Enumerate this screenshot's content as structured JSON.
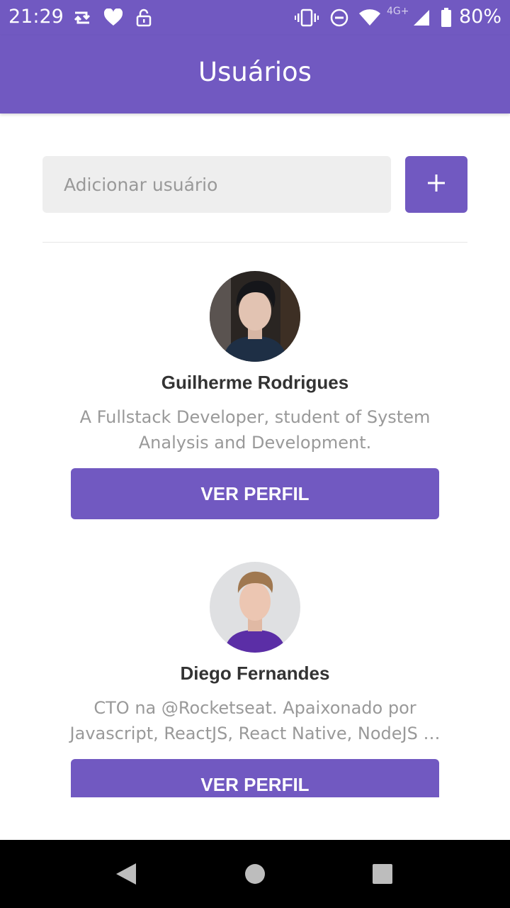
{
  "status_bar": {
    "time": "21:29",
    "network": "4G+",
    "battery": "80%",
    "icons": [
      "retweet-icon",
      "heart-icon",
      "unlock-icon",
      "vibrate-icon",
      "do-not-disturb-icon",
      "wifi-icon",
      "signal-icon",
      "battery-icon"
    ]
  },
  "app_bar": {
    "title": "Usuários"
  },
  "form": {
    "placeholder": "Adicionar usuário",
    "add_icon": "plus-icon"
  },
  "users": [
    {
      "name": "Guilherme Rodrigues",
      "bio": "A Fullstack Developer, student of System Analysis and Development.",
      "button_label": "VER PERFIL"
    },
    {
      "name": "Diego Fernandes",
      "bio": "CTO na @Rocketseat. Apaixonado por Javascript, ReactJS, React Native, NodeJS …",
      "button_label": "VER PERFIL"
    }
  ],
  "nav_bar": {
    "icons": [
      "back-icon",
      "home-icon",
      "recents-icon"
    ]
  },
  "colors": {
    "primary": "#7159c1",
    "input_bg": "#eeeeee",
    "text": "#333333",
    "muted": "#999999"
  }
}
